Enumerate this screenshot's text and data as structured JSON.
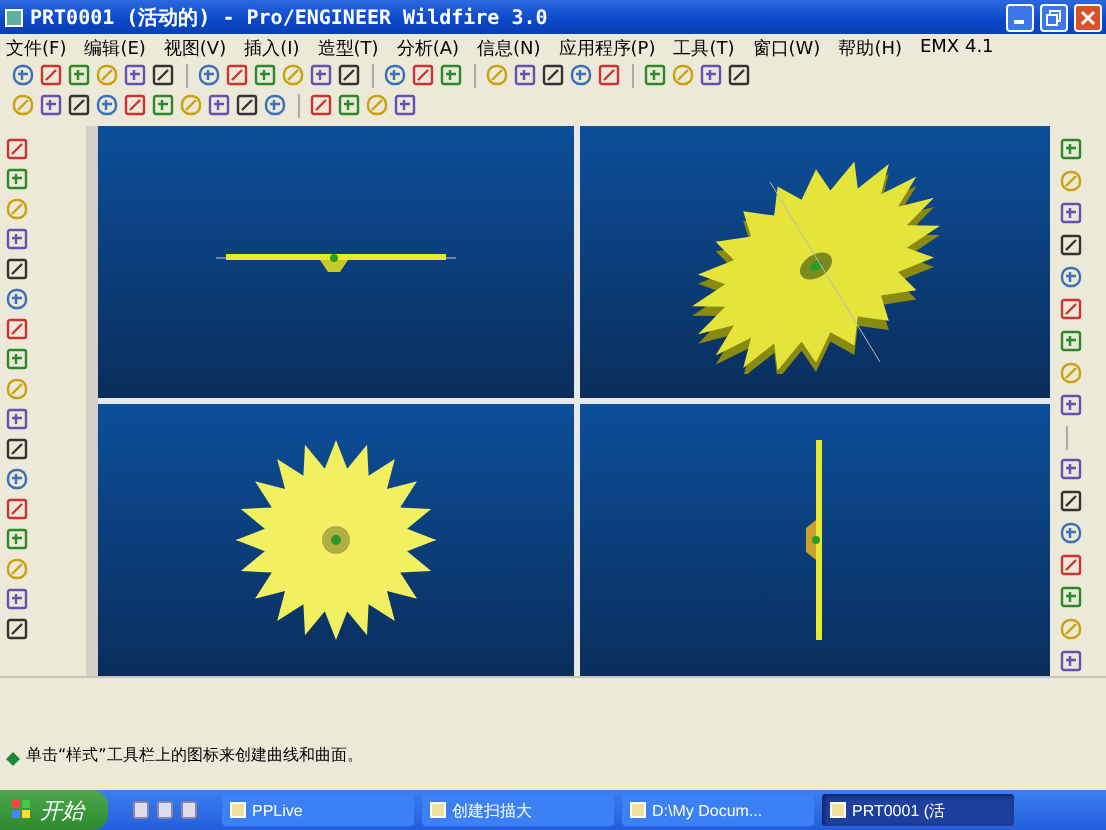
{
  "window": {
    "title": "PRT0001 (活动的) - Pro/ENGINEER Wildfire 3.0"
  },
  "menu": [
    "文件(F)",
    "编辑(E)",
    "视图(V)",
    "插入(I)",
    "造型(T)",
    "分析(A)",
    "信息(N)",
    "应用程序(P)",
    "工具(T)",
    "窗口(W)",
    "帮助(H)",
    "EMX 4.1"
  ],
  "viewports": [
    {
      "kind": "edge"
    },
    {
      "kind": "iso"
    },
    {
      "kind": "front"
    },
    {
      "kind": "side"
    }
  ],
  "message": "单击“样式”工具栏上的图标来创建曲线和曲面。",
  "taskbar": {
    "start": "开始",
    "tasks": [
      {
        "label": "PPLive",
        "selected": false
      },
      {
        "label": "创建扫描大",
        "selected": false
      },
      {
        "label": "D:\\My Docum...",
        "selected": false
      },
      {
        "label": "PRT0001 (活",
        "selected": true
      }
    ]
  }
}
